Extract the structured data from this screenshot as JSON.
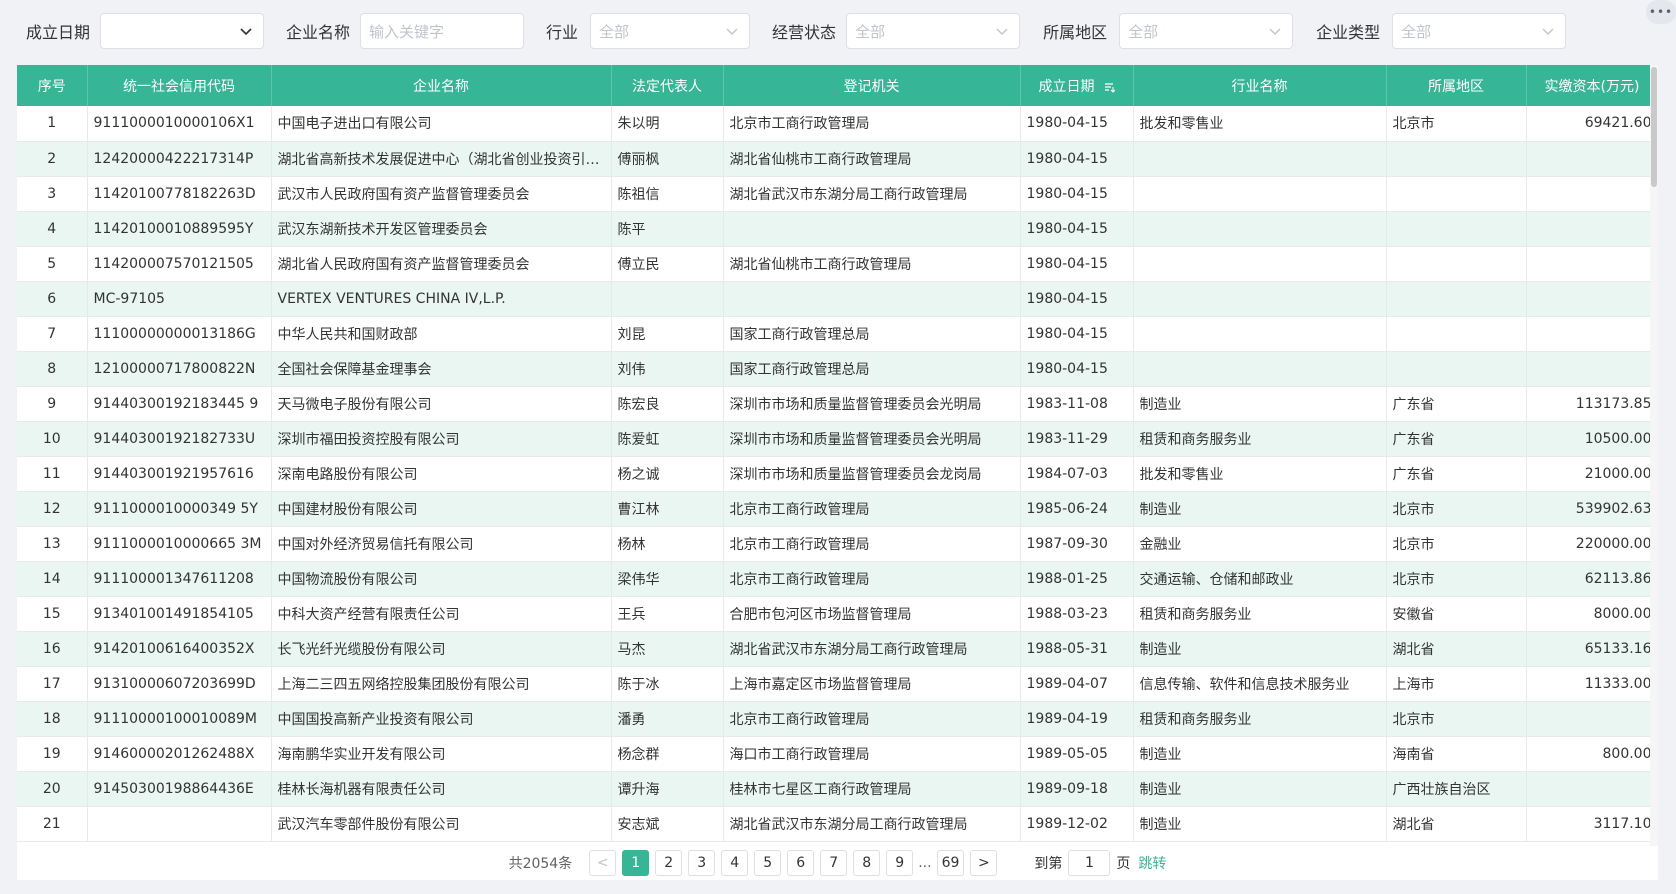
{
  "filters": {
    "established_date": {
      "label": "成立日期",
      "value": ""
    },
    "company_name": {
      "label": "企业名称",
      "placeholder": "输入关键字"
    },
    "industry": {
      "label": "行业",
      "value": "全部"
    },
    "status": {
      "label": "经营状态",
      "value": "全部"
    },
    "region": {
      "label": "所属地区",
      "value": "全部"
    },
    "type": {
      "label": "企业类型",
      "value": "全部"
    }
  },
  "corner_button": "•••",
  "columns": [
    "序号",
    "统一社会信用代码",
    "企业名称",
    "法定代表人",
    "登记机关",
    "成立日期",
    "行业名称",
    "所属地区",
    "实缴资本(万元)"
  ],
  "rows": [
    [
      "1",
      "9111000010000106X1",
      "中国电子进出口有限公司",
      "朱以明",
      "北京市工商行政管理局",
      "1980-04-15",
      "批发和零售业",
      "北京市",
      "69421.60"
    ],
    [
      "2",
      "12420000422217314P",
      "湖北省高新技术发展促进中心（湖北省创业投资引导基金管理中心）",
      "傅丽枫",
      "湖北省仙桃市工商行政管理局",
      "1980-04-15",
      "",
      "",
      ""
    ],
    [
      "3",
      "11420100778182263D",
      "武汉市人民政府国有资产监督管理委员会",
      "陈祖信",
      "湖北省武汉市东湖分局工商行政管理局",
      "1980-04-15",
      "",
      "",
      ""
    ],
    [
      "4",
      "11420100010889595Y",
      "武汉东湖新技术开发区管理委员会",
      "陈平",
      "",
      "1980-04-15",
      "",
      "",
      ""
    ],
    [
      "5",
      "114200007570121505",
      "湖北省人民政府国有资产监督管理委员会",
      "傅立民",
      "湖北省仙桃市工商行政管理局",
      "1980-04-15",
      "",
      "",
      ""
    ],
    [
      "6",
      "MC-97105",
      "VERTEX VENTURES CHINA IV,L.P.",
      "",
      "",
      "1980-04-15",
      "",
      "",
      ""
    ],
    [
      "7",
      "11100000000013186G",
      "中华人民共和国财政部",
      "刘昆",
      "国家工商行政管理总局",
      "1980-04-15",
      "",
      "",
      ""
    ],
    [
      "8",
      "12100000717800822N",
      "全国社会保障基金理事会",
      "刘伟",
      "国家工商行政管理总局",
      "1980-04-15",
      "",
      "",
      ""
    ],
    [
      "9",
      "91440300192183445 9",
      "天马微电子股份有限公司",
      "陈宏良",
      " 深圳市市场和质量监督管理委员会光明局",
      "1983-11-08",
      "制造业",
      "广东省",
      "113173.85"
    ],
    [
      "10",
      "91440300192182733U",
      "深圳市福田投资控股有限公司",
      "陈爱虹",
      " 深圳市市场和质量监督管理委员会光明局",
      "1983-11-29",
      "租赁和商务服务业",
      "广东省",
      "10500.00"
    ],
    [
      "11",
      "914403001921957616",
      "深南电路股份有限公司",
      "杨之诚",
      " 深圳市市场和质量监督管理委员会龙岗局",
      "1984-07-03",
      "批发和零售业",
      "广东省",
      "21000.00"
    ],
    [
      "12",
      "9111000010000349 5Y",
      "中国建材股份有限公司",
      "曹江林",
      "北京市工商行政管理局",
      "1985-06-24",
      "制造业",
      "北京市",
      "539902.63"
    ],
    [
      "13",
      "9111000010000665 3M",
      "中国对外经济贸易信托有限公司",
      "杨林",
      "北京市工商行政管理局",
      "1987-09-30",
      "金融业",
      "北京市",
      "220000.00"
    ],
    [
      "14",
      "911100001347611208",
      "中国物流股份有限公司",
      "梁伟华",
      "北京市工商行政管理局",
      "1988-01-25",
      "交通运输、仓储和邮政业",
      "北京市",
      "62113.86"
    ],
    [
      "15",
      "913401001491854105",
      "中科大资产经营有限责任公司",
      "王兵",
      "合肥市包河区市场监督管理局",
      "1988-03-23",
      "租赁和商务服务业",
      "安徽省",
      "8000.00"
    ],
    [
      "16",
      "91420100616400352X",
      "长飞光纤光缆股份有限公司",
      "马杰",
      "湖北省武汉市东湖分局工商行政管理局",
      "1988-05-31",
      "制造业",
      "湖北省",
      "65133.16"
    ],
    [
      "17",
      "91310000607203699D",
      "上海二三四五网络控股集团股份有限公司",
      "陈于冰",
      "上海市嘉定区市场监督管理局",
      "1989-04-07",
      "信息传输、软件和信息技术服务业",
      "上海市",
      "11333.00"
    ],
    [
      "18",
      "91110000100010089M",
      "中国国投高新产业投资有限公司",
      "潘勇",
      "北京市工商行政管理局",
      "1989-04-19",
      "租赁和商务服务业",
      "北京市",
      ""
    ],
    [
      "19",
      "91460000201262488X",
      "海南鹏华实业开发有限公司",
      "杨念群",
      "海口市工商行政管理局",
      "1989-05-05",
      "制造业",
      "海南省",
      "800.00"
    ],
    [
      "20",
      "91450300198864436E",
      "桂林长海机器有限责任公司",
      "谭升海",
      "桂林市七星区工商行政管理局",
      "1989-09-18",
      "制造业",
      "广西壮族自治区",
      ""
    ],
    [
      "21",
      "",
      "武汉汽车零部件股份有限公司",
      "安志斌",
      "湖北省武汉市东湖分局工商行政管理局",
      "1989-12-02",
      "制造业",
      "湖北省",
      "3117.10"
    ]
  ],
  "pagination": {
    "total": "共2054条",
    "prev": "<",
    "pages": [
      "1",
      "2",
      "3",
      "4",
      "5",
      "6",
      "7",
      "8",
      "9"
    ],
    "active_page": "1",
    "ellipsis": "...",
    "last_page": "69",
    "next": ">",
    "goto_label": "到第",
    "goto_value": "1",
    "goto_unit": "页",
    "goto_button": "跳转"
  },
  "colors": {
    "accent": "#37b597",
    "stripe": "#e9f6f2"
  }
}
